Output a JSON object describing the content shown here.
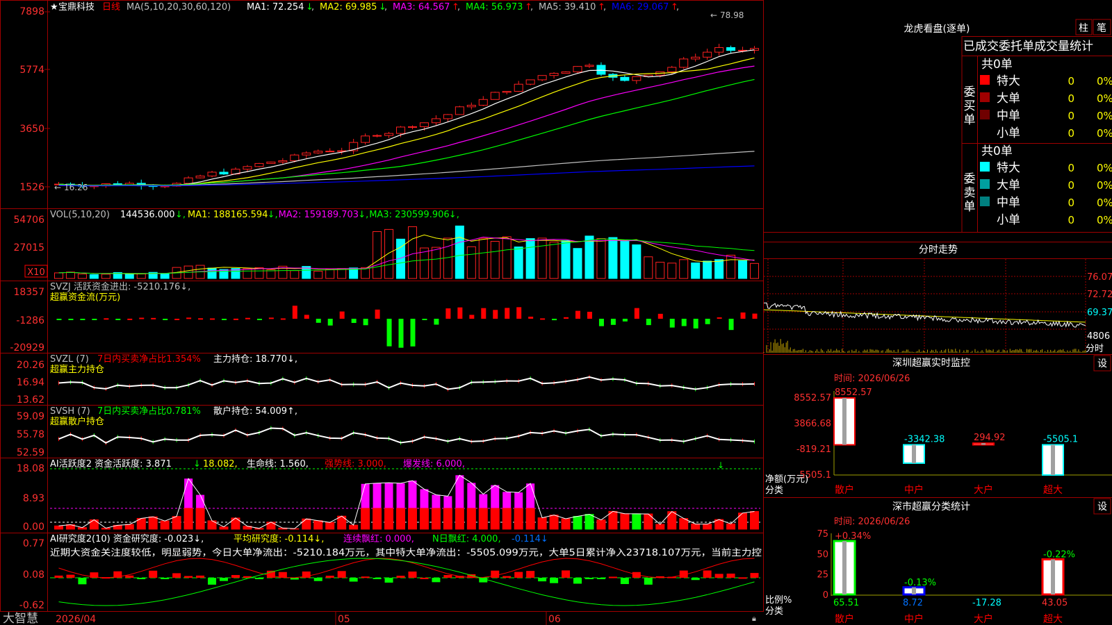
{
  "stock": {
    "name": "宝鼎科技",
    "period": "日线"
  },
  "main_panel": {
    "ma_header": "MA(5,10,20,30,60,120)",
    "ma_items": [
      {
        "label": "MA1:",
        "value": "72.254",
        "arrow": "↓",
        "color": "#ffffff"
      },
      {
        "label": "MA2:",
        "value": "69.985",
        "arrow": "↓",
        "color": "#ffff00"
      },
      {
        "label": "MA3:",
        "value": "64.567",
        "arrow": "↑",
        "color": "#ff00ff"
      },
      {
        "label": "MA4:",
        "value": "56.973",
        "arrow": "↑",
        "color": "#00ff00"
      },
      {
        "label": "MA5:",
        "value": "39.410",
        "arrow": "↑",
        "color": "#c0c0c0"
      },
      {
        "label": "MA6:",
        "value": "29.067",
        "arrow": "↑",
        "color": "#0000ff"
      }
    ],
    "axis": [
      "7898",
      "5774",
      "3650",
      "1526"
    ],
    "high_label": "78.98",
    "low_label": "16.26"
  },
  "vol_panel": {
    "header": "VOL(5,10,20)",
    "value": "144536.000",
    "items": [
      {
        "label": "MA1:",
        "value": "188165.594",
        "arrow": "↓",
        "color": "#ffff00"
      },
      {
        "label": "MA2:",
        "value": "159189.703",
        "arrow": "↓",
        "color": "#ff00ff"
      },
      {
        "label": "MA3:",
        "value": "230599.906",
        "arrow": "↓",
        "color": "#00ff00"
      }
    ],
    "axis": [
      "54706",
      "27015"
    ],
    "unit": "X10"
  },
  "svzj_panel": {
    "line1": "SVZJ  活跃资金进出: -5210.176↓,",
    "line2": "超赢资金流(万元)",
    "axis": [
      "18357",
      "-1286",
      "-20929"
    ]
  },
  "svzl_panel": {
    "prefix": "SVZL (7)",
    "mid": "7日内买卖净占比1.354%",
    "tail": "主力持仓: 18.770↓,",
    "line2": "超赢主力持仓",
    "axis": [
      "20.26",
      "16.94",
      "13.62"
    ]
  },
  "svsh_panel": {
    "prefix": "SVSH (7)",
    "mid": "7日内买卖净占比0.781%",
    "tail": "散户持仓: 54.009↑,",
    "line2": "超赢散户持仓",
    "axis": [
      "59.09",
      "55.78",
      "52.59"
    ]
  },
  "ai_active_panel": {
    "a": "AI活跃度2 资金活跃度: 3.871",
    "a_arrow": "↓",
    "b": "18.082,",
    "c": "生命线: 1.560,",
    "d": "强势线: 3.000,",
    "e": "爆发线: 6.000,",
    "axis": [
      "18.08",
      "8.93",
      "0.00"
    ]
  },
  "ai_research_panel": {
    "a": "AI研究度2(10) 资金研究度: -0.023↓,",
    "b": "平均研究度: -0.114↓,",
    "c": "连续飘红: 0.000,",
    "d": "N日飘红: 4.000,",
    "e": "-0.114↓",
    "text": "近期大资金关注度较低，明显弱势，今日大单净流出：-5210.184万元，其中特大单净流出：-5505.099万元，大单5日累计净入23718.107万元，当前主力控",
    "axis": [
      "0.77",
      "0.08",
      "-0.62"
    ]
  },
  "bottom_bar": {
    "brand": "大智慧",
    "date": "2026/04",
    "month1": "05",
    "month2": "06"
  },
  "longhu": {
    "title": "龙虎看盘(逐单)",
    "btn1": "柱",
    "btn2": "笔",
    "tabs": "已成交委托单成交量统计",
    "buy": {
      "side": "委买单",
      "total": "共0单",
      "rows": [
        {
          "name": "特大",
          "count": "0",
          "pct": "0%",
          "color": "#ff0000"
        },
        {
          "name": "大单",
          "count": "0",
          "pct": "0%",
          "color": "#a00000"
        },
        {
          "name": "中单",
          "count": "0",
          "pct": "0%",
          "color": "#700000"
        },
        {
          "name": "小单",
          "count": "0",
          "pct": "0%",
          "color": ""
        }
      ]
    },
    "sell": {
      "side": "委卖单",
      "total": "共0单",
      "rows": [
        {
          "name": "特大",
          "count": "0",
          "pct": "0%",
          "color": "#00ffff"
        },
        {
          "name": "大单",
          "count": "0",
          "pct": "0%",
          "color": "#00a0a0"
        },
        {
          "name": "中单",
          "count": "0",
          "pct": "0%",
          "color": "#008080"
        },
        {
          "name": "小单",
          "count": "0",
          "pct": "0%",
          "color": ""
        }
      ]
    }
  },
  "fenshi": {
    "title": "分时走势",
    "axis": [
      "76.07",
      "72.72",
      "69.37"
    ],
    "vol": "4806",
    "vol_unit": "分时"
  },
  "sz_monitor": {
    "title": "深圳超赢实时监控",
    "btn": "设",
    "time": "时间: 2026/06/26",
    "axis": [
      "8552.57",
      "3866.68",
      "-819.21",
      "-5505.1"
    ],
    "ylabel": "净额(万元)",
    "xlabel": "分类",
    "bars": [
      {
        "cat": "散户",
        "value": 8552.57,
        "label": "8552.57"
      },
      {
        "cat": "中户",
        "value": -3342.38,
        "label": "-3342.38"
      },
      {
        "cat": "大户",
        "value": 294.92,
        "label": "294.92"
      },
      {
        "cat": "超大",
        "value": -5505.1,
        "label": "-5505.1"
      }
    ]
  },
  "sz_class": {
    "title": "深市超赢分类统计",
    "btn": "设",
    "time": "时间: 2026/06/26",
    "axis": [
      "75",
      "50",
      "25",
      "0"
    ],
    "ylabel": "比例%",
    "xlabel": "分类",
    "bars": [
      {
        "cat": "散户",
        "value": 65.51,
        "label": "65.51",
        "change": "+0.34%"
      },
      {
        "cat": "中户",
        "value": 8.72,
        "label": "8.72",
        "change": "-0.13%"
      },
      {
        "cat": "大户",
        "value": -17.28,
        "label": "-17.28",
        "change": ""
      },
      {
        "cat": "超大",
        "value": 43.05,
        "label": "43.05",
        "change": "-0.22%"
      }
    ]
  }
}
